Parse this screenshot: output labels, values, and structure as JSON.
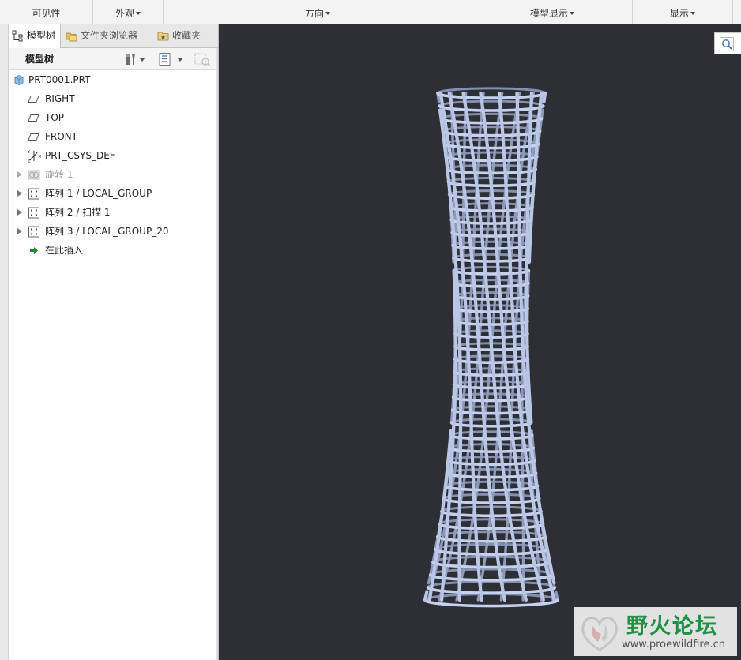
{
  "ribbon": {
    "groups": [
      {
        "label": "可见性",
        "dropdown": false
      },
      {
        "label": "外观",
        "dropdown": true
      },
      {
        "label": "方向",
        "dropdown": true
      },
      {
        "label": "模型显示",
        "dropdown": true
      },
      {
        "label": "显示",
        "dropdown": true
      }
    ]
  },
  "tabs": [
    {
      "label": "模型树",
      "icon": "model-tree-icon",
      "active": true
    },
    {
      "label": "文件夹浏览器",
      "icon": "folder-browser-icon",
      "active": false
    },
    {
      "label": "收藏夹",
      "icon": "favorites-icon",
      "active": false
    }
  ],
  "tree_header": {
    "title": "模型树",
    "tools": [
      "settings-icon",
      "show-icon",
      "filter-icon"
    ]
  },
  "tree": {
    "items": [
      {
        "label": "PRT0001.PRT",
        "icon": "part-icon",
        "expandable": false,
        "dimmed": false
      },
      {
        "label": "RIGHT",
        "icon": "datum-plane-icon",
        "expandable": false,
        "dimmed": false
      },
      {
        "label": "TOP",
        "icon": "datum-plane-icon",
        "expandable": false,
        "dimmed": false
      },
      {
        "label": "FRONT",
        "icon": "datum-plane-icon",
        "expandable": false,
        "dimmed": false
      },
      {
        "label": "PRT_CSYS_DEF",
        "icon": "coordinate-system-icon",
        "expandable": false,
        "dimmed": false
      },
      {
        "label": "旋转 1",
        "icon": "revolve-icon",
        "expandable": true,
        "dimmed": true
      },
      {
        "label": "阵列 1 / LOCAL_GROUP",
        "icon": "pattern-icon",
        "expandable": true,
        "dimmed": false
      },
      {
        "label": "阵列 2 / 扫描 1",
        "icon": "pattern-icon",
        "expandable": true,
        "dimmed": false
      },
      {
        "label": "阵列 3 / LOCAL_GROUP_20",
        "icon": "pattern-icon",
        "expandable": true,
        "dimmed": false
      },
      {
        "label": "在此插入",
        "icon": "insert-here-arrow-icon",
        "expandable": false,
        "dimmed": false
      }
    ]
  },
  "viewport": {
    "background": "#2e2e35",
    "model_color": "#b9c6e6",
    "tool_icon": "zoom-icon"
  },
  "watermark": {
    "title": "野火论坛",
    "url": "www.proewildfire.cn"
  }
}
